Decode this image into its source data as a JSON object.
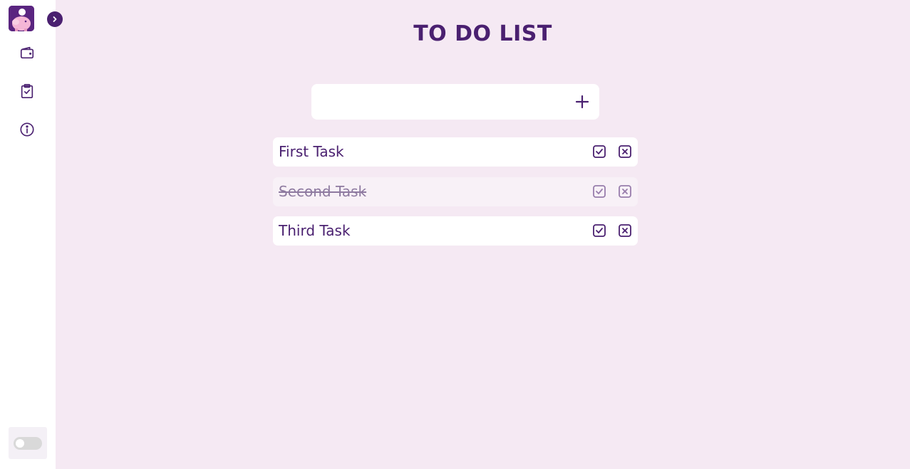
{
  "header": {
    "title": "TO DO LIST"
  },
  "sidebar": {
    "logo_icon": "piggy-bank-icon",
    "expand_icon": "chevron-right-icon",
    "items": [
      {
        "icon": "wallet-icon"
      },
      {
        "icon": "clipboard-check-icon"
      },
      {
        "icon": "info-icon"
      }
    ],
    "theme_toggle": {
      "on": false
    }
  },
  "add_task": {
    "value": "",
    "placeholder": "",
    "button_icon": "plus-icon"
  },
  "tasks": [
    {
      "label": "First Task",
      "done": false
    },
    {
      "label": "Second Task",
      "done": true
    },
    {
      "label": "Third Task",
      "done": false
    }
  ],
  "colors": {
    "accent": "#4a2070",
    "background": "#f5e9f3",
    "card": "#ffffff"
  }
}
